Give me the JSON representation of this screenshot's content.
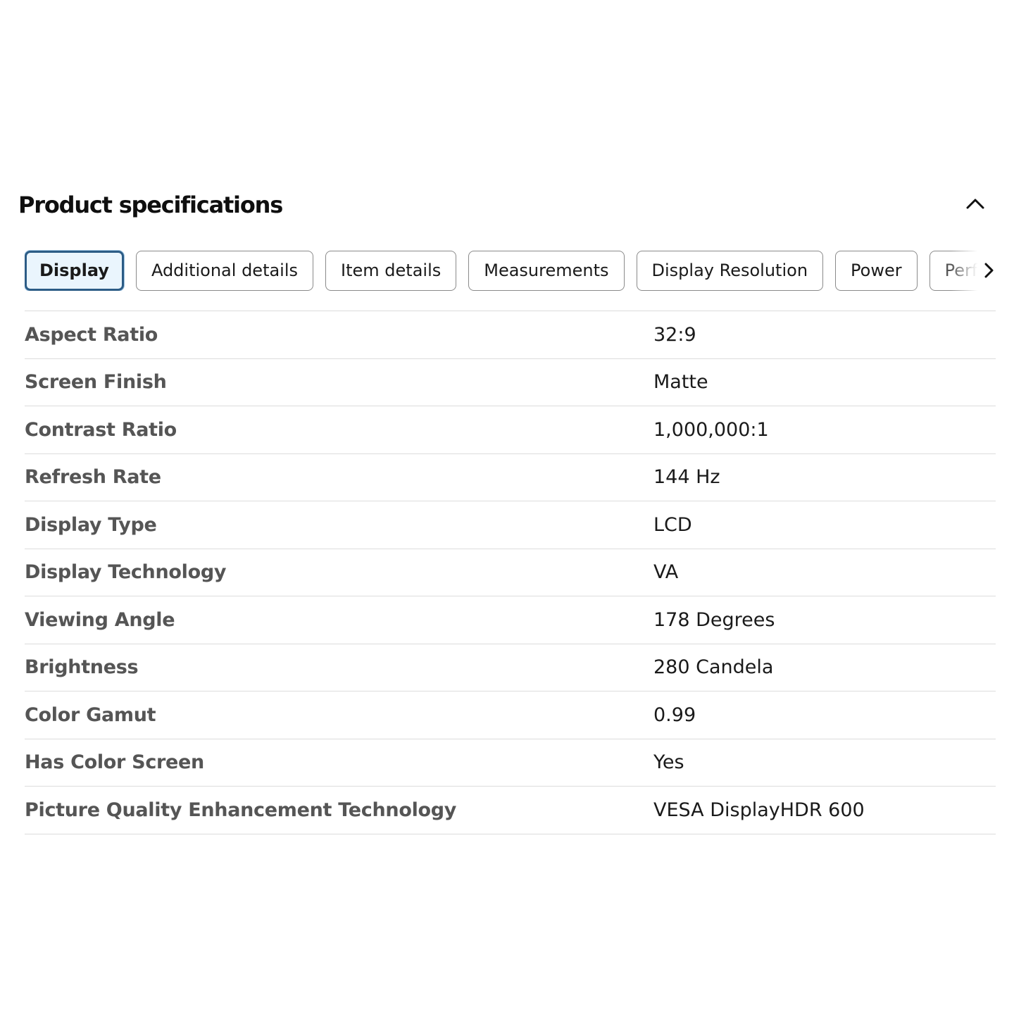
{
  "section": {
    "title": "Product specifications",
    "collapse_icon": "chevron-up-icon"
  },
  "tabs": [
    {
      "label": "Display",
      "active": true
    },
    {
      "label": "Additional details",
      "active": false
    },
    {
      "label": "Item details",
      "active": false
    },
    {
      "label": "Measurements",
      "active": false
    },
    {
      "label": "Display Resolution",
      "active": false
    },
    {
      "label": "Power",
      "active": false
    },
    {
      "label": "Perfor",
      "active": false
    }
  ],
  "scroll_icon": "chevron-right-icon",
  "specs": [
    {
      "label": "Aspect Ratio",
      "value": "32:9"
    },
    {
      "label": "Screen Finish",
      "value": "Matte"
    },
    {
      "label": "Contrast Ratio",
      "value": "1,000,000:1"
    },
    {
      "label": "Refresh Rate",
      "value": "144 Hz"
    },
    {
      "label": "Display Type",
      "value": "LCD"
    },
    {
      "label": "Display Technology",
      "value": "VA"
    },
    {
      "label": "Viewing Angle",
      "value": "178 Degrees"
    },
    {
      "label": "Brightness",
      "value": "280 Candela"
    },
    {
      "label": "Color Gamut",
      "value": "0.99"
    },
    {
      "label": "Has Color Screen",
      "value": "Yes"
    },
    {
      "label": "Picture Quality Enhancement Technology",
      "value": "VESA DisplayHDR 600"
    }
  ],
  "colors": {
    "active_tab_border": "#2c5c86",
    "active_tab_bg": "#eaf5fd",
    "label_text": "#555555",
    "divider": "#dcdcdc"
  }
}
